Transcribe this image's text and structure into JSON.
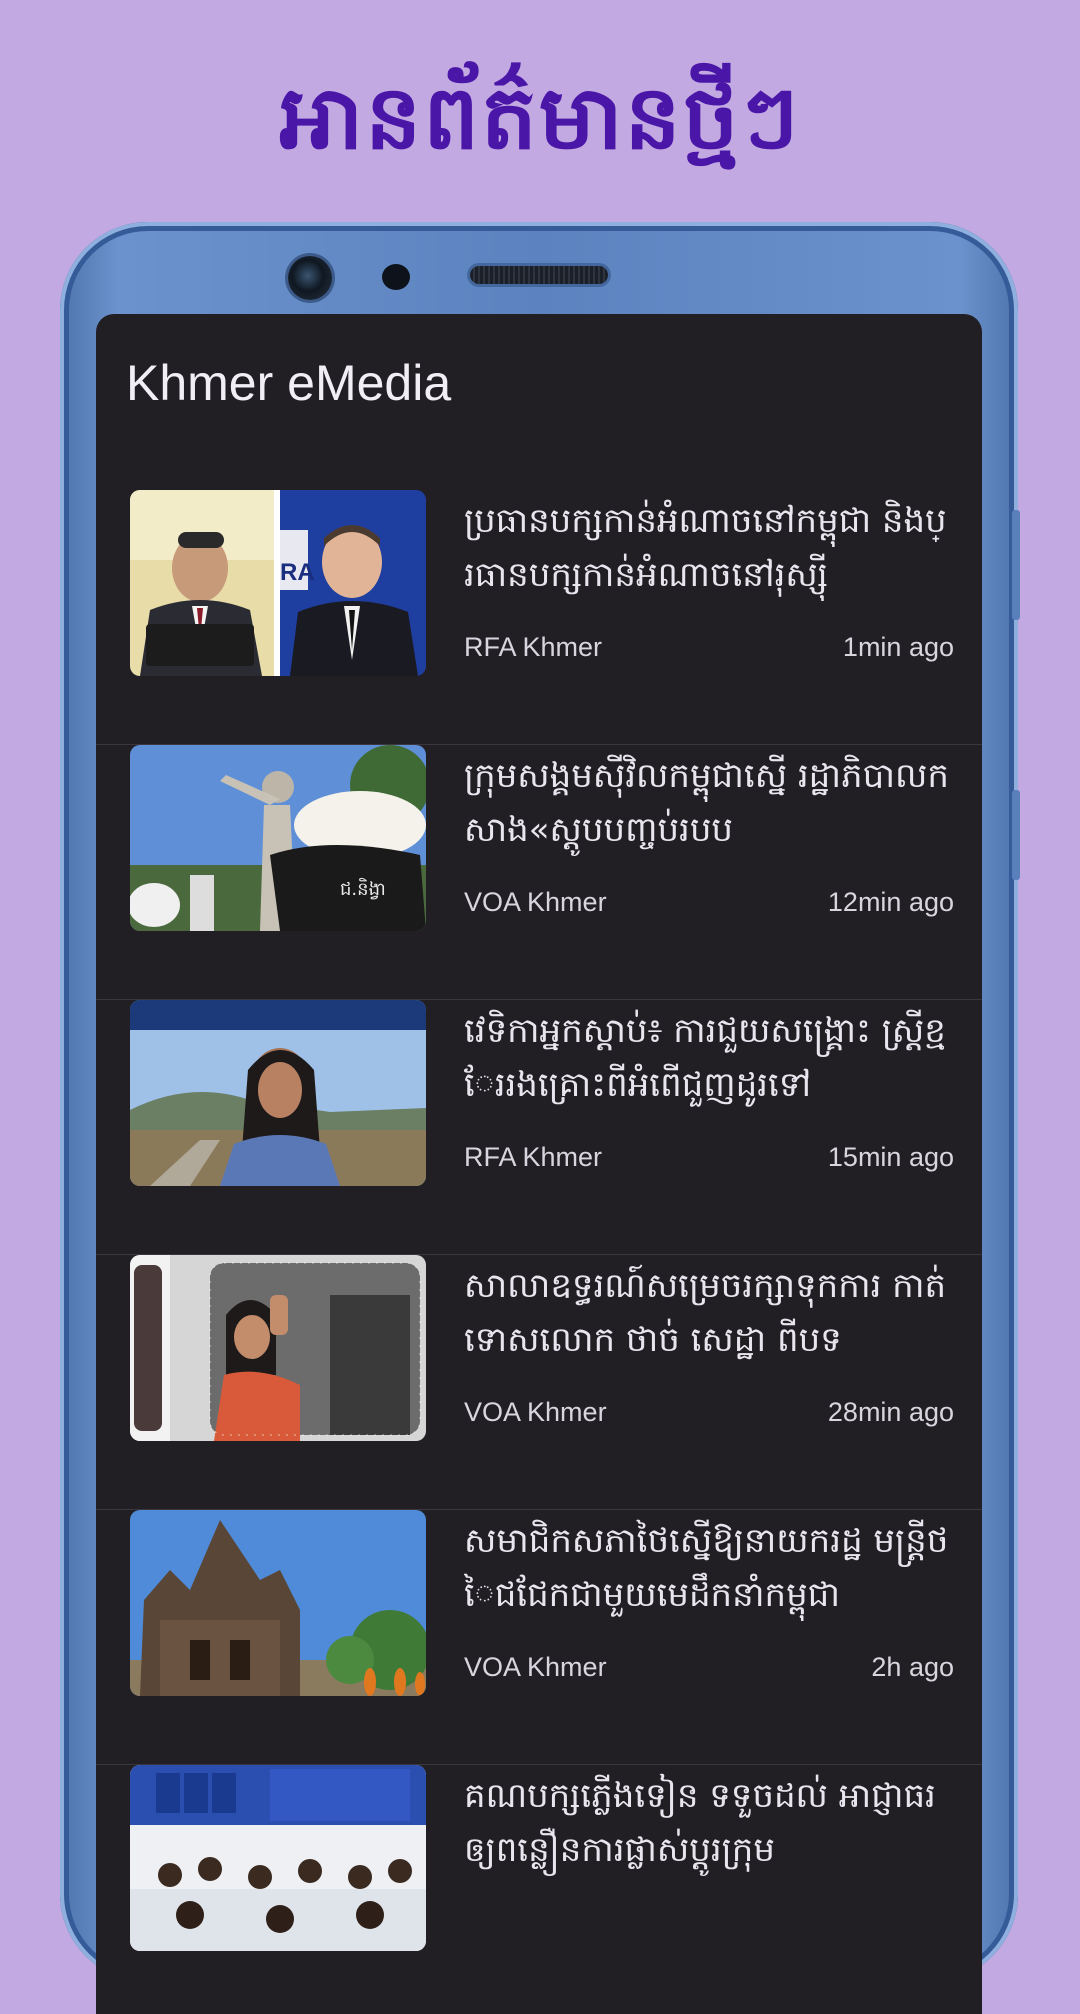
{
  "promo": {
    "title": "អានព័ត៌មានថ្មីៗ"
  },
  "app": {
    "title": "Khmer eMedia"
  },
  "articles": [
    {
      "headline": "ប្រធានបក្សកាន់អំណាចនៅកម្ពុជា និងប្រធានបក្សកាន់អំណាចនៅរុស្ស៊ី",
      "source": "RFA Khmer",
      "time": "1min ago"
    },
    {
      "headline": "ក្រុមសង្គមស៊ីវិលកម្ពុជាស្នើ រដ្ឋាភិបាលកសាង«ស្តូបបញ្ចប់របប",
      "source": "VOA Khmer",
      "time": "12min ago"
    },
    {
      "headline": "វេទិកាអ្នកស្តាប់៖ ការជួយសង្គ្រោះ ស្ត្រីខ្មែររងគ្រោះពីអំពើជួញដូរទៅ",
      "source": "RFA Khmer",
      "time": "15min ago"
    },
    {
      "headline": "សាលាឧទ្ធរណ៍សម្រេចរក្សាទុកការ កាត់ទោសលោក ថាច់ សេដ្ឋា ពីបទ",
      "source": "VOA Khmer",
      "time": "28min ago"
    },
    {
      "headline": "សមាជិកសភាថៃស្នើឱ្យនាយករដ្ឋ មន្ត្រីថៃជជែកជាមួយមេដឹកនាំកម្ពុជា",
      "source": "VOA Khmer",
      "time": "2h ago"
    },
    {
      "headline": "គណបក្សភ្លើងទៀន ទទួចដល់ អាជ្ញាធរឲ្យពន្លឿនការផ្លាស់ប្តូរក្រុម",
      "source": "",
      "time": ""
    }
  ],
  "colors": {
    "background": "#c3a9e1",
    "title": "#4a16a8",
    "screen": "#211f24",
    "phone": "#5c83bf"
  }
}
